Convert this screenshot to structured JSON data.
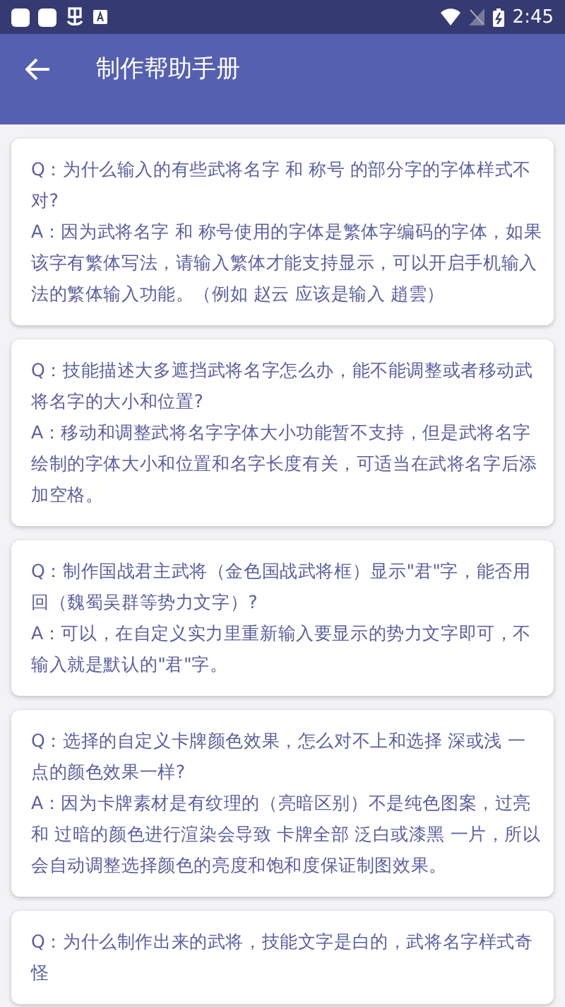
{
  "status_bar": {
    "time": "2:45"
  },
  "app_bar": {
    "title": "制作帮助手册"
  },
  "faq": [
    {
      "q": "Q：为什么输入的有些武将名字 和 称号 的部分字的字体样式不对?",
      "a": "A：因为武将名字 和 称号使用的字体是繁体字编码的字体，如果该字有繁体写法，请输入繁体才能支持显示，可以开启手机输入法的繁体输入功能。（例如 赵云 应该是输入 趙雲）"
    },
    {
      "q": "Q：技能描述大多遮挡武将名字怎么办，能不能调整或者移动武将名字的大小和位置?",
      "a": "A：移动和调整武将名字字体大小功能暂不支持，但是武将名字绘制的字体大小和位置和名字长度有关，可适当在武将名字后添加空格。"
    },
    {
      "q": "Q：制作国战君主武将（金色国战武将框）显示\"君\"字，能否用回（魏蜀吴群等势力文字）?",
      "a": "A：可以，在自定义实力里重新输入要显示的势力文字即可，不输入就是默认的\"君\"字。"
    },
    {
      "q": "Q：选择的自定义卡牌颜色效果，怎么对不上和选择 深或浅 一点的颜色效果一样?",
      "a": "A：因为卡牌素材是有纹理的（亮暗区别）不是纯色图案，过亮和 过暗的颜色进行渲染会导致 卡牌全部 泛白或漆黑 一片，所以会自动调整选择颜色的亮度和饱和度保证制图效果。"
    },
    {
      "q": "Q：为什么制作出来的武将，技能文字是白的，武将名字样式奇怪"
    }
  ]
}
